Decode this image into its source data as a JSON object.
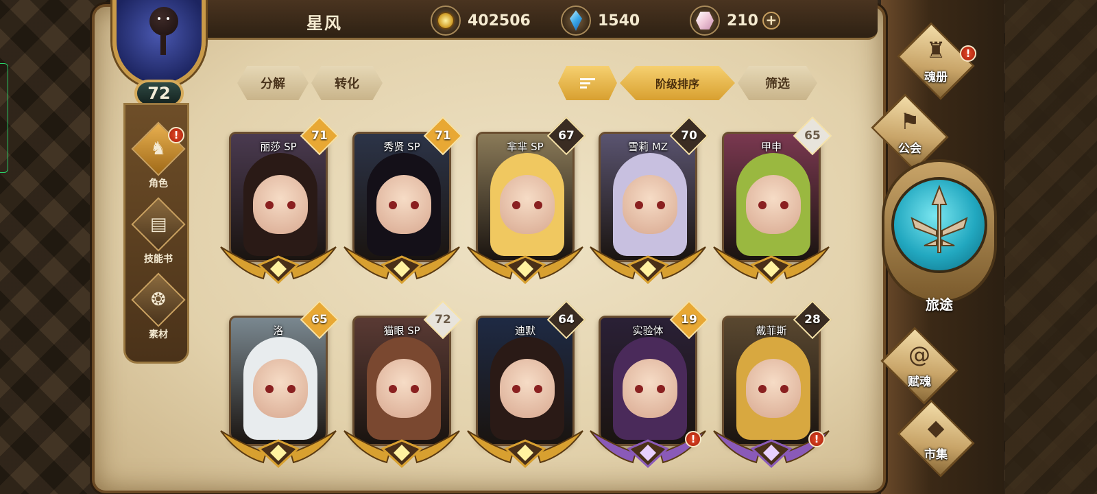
{
  "player": {
    "name": "星风",
    "level": "72"
  },
  "currencies": [
    {
      "icon": "gold-coin-icon",
      "value": "402506"
    },
    {
      "icon": "blue-crystal-icon",
      "value": "1540"
    },
    {
      "icon": "pink-gem-icon",
      "value": "210"
    }
  ],
  "add_label": "+",
  "left_nav": [
    {
      "label": "角色",
      "icon": "character-helmet-icon",
      "active": true,
      "alert": true
    },
    {
      "label": "技能书",
      "icon": "skill-book-icon",
      "active": false,
      "alert": false
    },
    {
      "label": "素材",
      "icon": "material-icon",
      "active": false,
      "alert": false
    }
  ],
  "alert_mark": "!",
  "toolbar": {
    "decompose": "分解",
    "convert": "转化",
    "sort_by_rank": "阶级排序",
    "filter": "筛选"
  },
  "heroes": [
    {
      "name": "丽莎 SP",
      "level": "71",
      "badge": "gold",
      "wings": "gold",
      "hair": "#2a1a16",
      "bg": "#4a3a50",
      "alert": false
    },
    {
      "name": "秀贤 SP",
      "level": "71",
      "badge": "gold",
      "wings": "gold",
      "hair": "#141018",
      "bg": "#2c3448",
      "alert": false
    },
    {
      "name": "芈芈 SP",
      "level": "67",
      "badge": "dark",
      "wings": "gold",
      "hair": "#f0c860",
      "bg": "#8a7a58",
      "alert": false
    },
    {
      "name": "雪莉 MZ",
      "level": "70",
      "badge": "dark",
      "wings": "gold",
      "hair": "#c8c0e0",
      "bg": "#5a5470",
      "alert": false
    },
    {
      "name": "甲申",
      "level": "65",
      "badge": "white",
      "wings": "gold",
      "hair": "#9ab840",
      "bg": "#7a3850",
      "alert": false
    },
    {
      "name": "洛",
      "level": "65",
      "badge": "gold",
      "wings": "gold",
      "hair": "#e8ecee",
      "bg": "#7a8890",
      "alert": false
    },
    {
      "name": "猫眼 SP",
      "level": "72",
      "badge": "white",
      "wings": "gold",
      "hair": "#7a4830",
      "bg": "#5a3a34",
      "alert": false
    },
    {
      "name": "迪默",
      "level": "64",
      "badge": "dark",
      "wings": "gold",
      "hair": "#2a1a16",
      "bg": "#1e2a44",
      "alert": false
    },
    {
      "name": "实验体",
      "level": "19",
      "badge": "gold",
      "wings": "purple",
      "hair": "#4a2a5a",
      "bg": "#2a2036",
      "alert": true
    },
    {
      "name": "戴菲斯",
      "level": "28",
      "badge": "dark",
      "wings": "purple",
      "hair": "#d8a840",
      "bg": "#5a4830",
      "alert": true
    }
  ],
  "right_menu": {
    "soul_book": "魂册",
    "guild": "公会",
    "journey": "旅途",
    "soul_grant": "赋魂",
    "market": "市集"
  },
  "colors": {
    "badge_gold": "#e8a834",
    "badge_dark": "#3a2c22",
    "badge_white": "#e8e4dc",
    "wings_gold": "#d8a030",
    "wings_purple": "#8a5ab8"
  }
}
